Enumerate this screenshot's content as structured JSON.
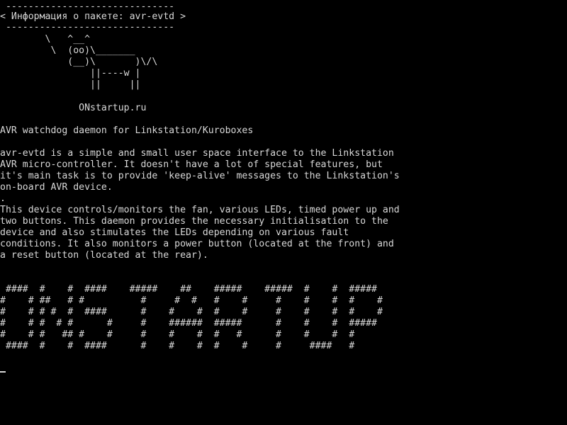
{
  "terminal": {
    "cowsay": {
      "border_top": " ------------------------------",
      "message": "< Информация о пакете: avr-evtd >",
      "border_bottom": " ------------------------------",
      "cow_1": "        \\   ^__^",
      "cow_2": "         \\  (oo)\\_______",
      "cow_3": "            (__)\\       )\\/\\",
      "cow_4": "                ||----w |",
      "cow_5": "                ||     ||"
    },
    "site": "              ONstartup.ru",
    "summary": "AVR watchdog daemon for Linkstation/Kuroboxes",
    "description": [
      "avr-evtd is a simple and small user space interface to the Linkstation",
      "AVR micro-controller. It doesn't have a lot of special features, but",
      "it's main task is to provide 'keep-alive' messages to the Linkstation's",
      "on-board AVR device.",
      ".",
      "This device controls/monitors the fan, various LEDs, timed power up and",
      "two buttons. This daemon provides the necessary initialisation to the",
      "device and also stimulates the LEDs depending on various fault",
      "conditions. It also monitors a power button (located at the front) and",
      "a reset button (located at the rear)."
    ],
    "banner": [
      " ####  #    #  ####    #####    ##    #####    #####  #    #  #####",
      "#    # ##   # #          #     #  #   #    #     #    #    #  #    #",
      "#    # # #  #  ####      #    #    #  #    #     #    #    #  #    #",
      "#    # #  # #      #     #    ######  #####      #    #    #  #####",
      "#    # #   ## #    #     #    #    #  #   #      #    #    #  #",
      " ####  #    #  ####      #    #    #  #    #     #     ####   #"
    ]
  }
}
